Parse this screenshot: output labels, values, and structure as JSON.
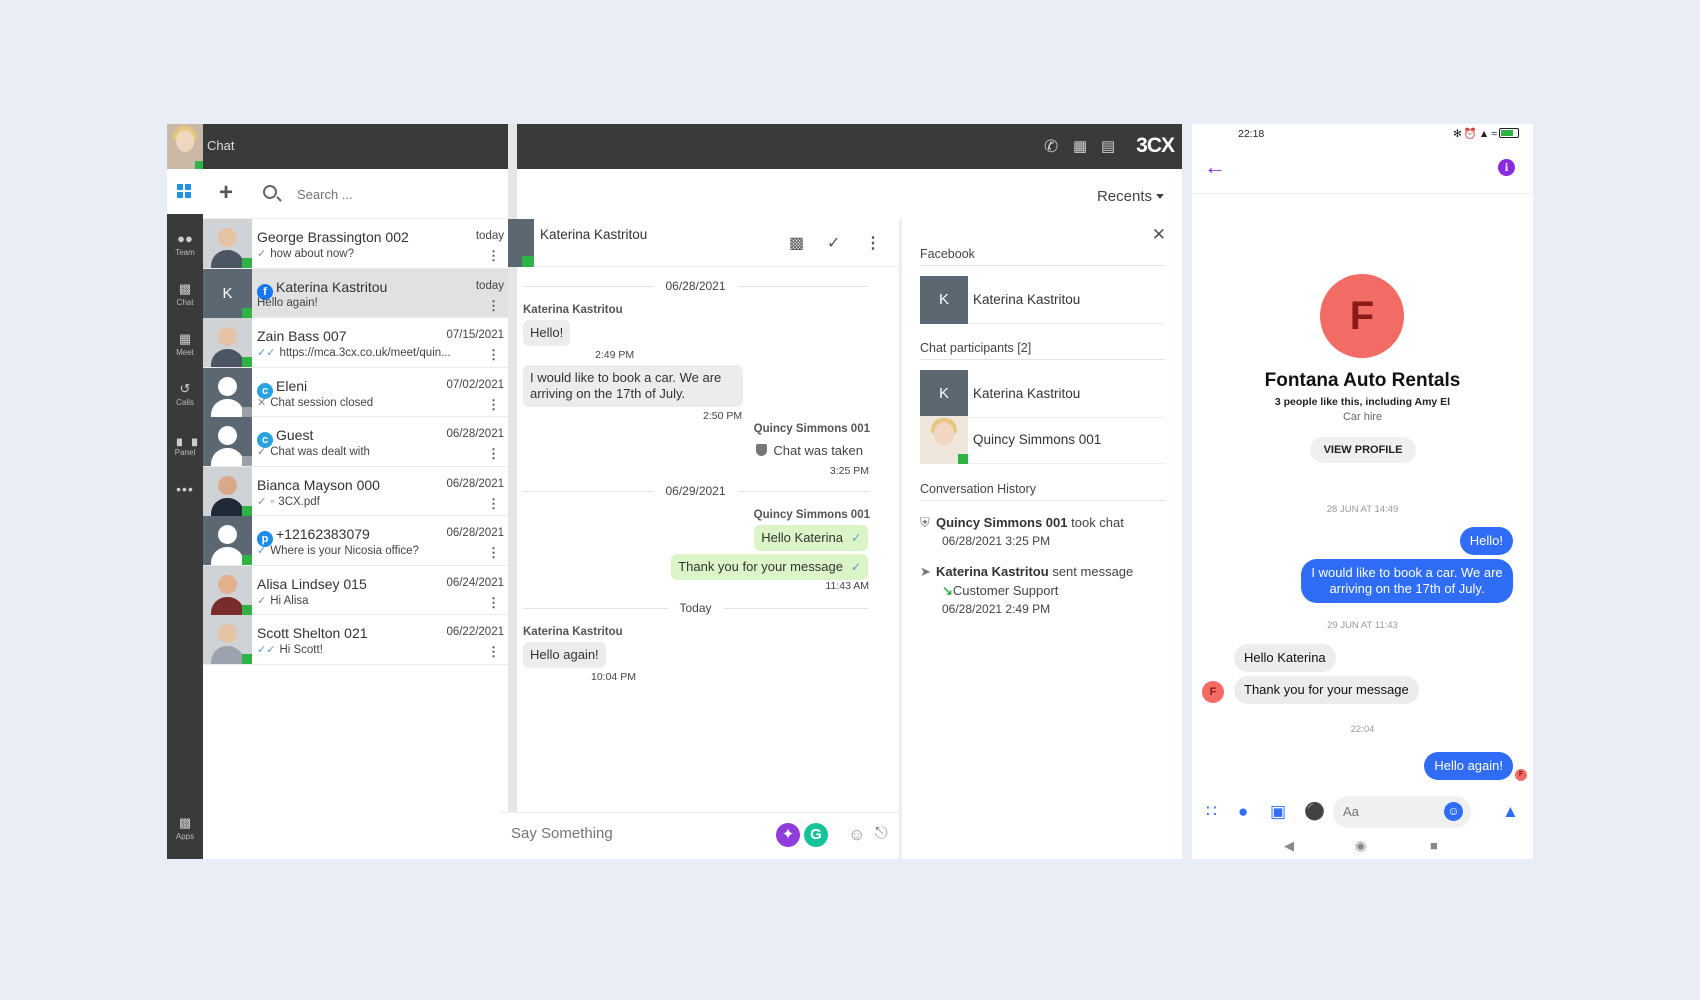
{
  "app": {
    "header_title": "Chat",
    "brand": "3CX",
    "search_placeholder": "Search ...",
    "recents_label": "Recents",
    "rail": [
      {
        "label": "Team",
        "icon": "team-icon"
      },
      {
        "label": "Chat",
        "icon": "chat-icon"
      },
      {
        "label": "Meet",
        "icon": "meet-icon"
      },
      {
        "label": "Calls",
        "icon": "calls-icon"
      },
      {
        "label": "Panel",
        "icon": "panel-icon"
      },
      {
        "label": "Apps",
        "icon": "apps-icon"
      }
    ],
    "more_label": "•••"
  },
  "chats": [
    {
      "name": "George Brassington 002",
      "preview": "how about now?",
      "date": "today",
      "tick": "✓",
      "avatar": "photo",
      "source": ""
    },
    {
      "name": "Katerina Kastritou",
      "preview": "Hello again!",
      "date": "today",
      "tick": "",
      "avatar": "K",
      "source": "f"
    },
    {
      "name": "Zain Bass 007",
      "preview": "https://mca.3cx.co.uk/meet/quin...",
      "date": "07/15/2021",
      "tick": "✓✓",
      "avatar": "photo",
      "source": ""
    },
    {
      "name": "Eleni",
      "preview": "Chat session closed",
      "date": "07/02/2021",
      "tick": "✕",
      "avatar": "ghost",
      "source": "c"
    },
    {
      "name": "Guest",
      "preview": "Chat was dealt with",
      "date": "06/28/2021",
      "tick": "✓",
      "avatar": "ghost",
      "source": "c"
    },
    {
      "name": "Bianca Mayson 000",
      "preview": "3CX.pdf",
      "date": "06/28/2021",
      "tick": "✓",
      "avatar": "photo",
      "source": ""
    },
    {
      "name": "+12162383079",
      "preview": "Where is your Nicosia office?",
      "date": "06/28/2021",
      "tick": "✓",
      "avatar": "ghost",
      "source": "p"
    },
    {
      "name": "Alisa Lindsey 015",
      "preview": "Hi Alisa",
      "date": "06/24/2021",
      "tick": "✓",
      "avatar": "photo",
      "source": ""
    },
    {
      "name": "Scott Shelton 021",
      "preview": "Hi Scott!",
      "date": "06/22/2021",
      "tick": "✓✓",
      "avatar": "photo",
      "source": ""
    }
  ],
  "conversation": {
    "contact": "Katerina Kastritou",
    "dates": [
      "06/28/2021",
      "06/29/2021",
      "Today"
    ],
    "m1_sender": "Katerina Kastritou",
    "m1_text": "Hello!",
    "m1_time": "2:49 PM",
    "m2_text_a": "I would like to book a car. We are",
    "m2_text_b": "arriving on the 17th of July.",
    "m2_time": "2:50 PM",
    "m3_sender": "Quincy Simmons 001",
    "m3_text": "Chat was taken",
    "m3_time": "3:25 PM",
    "m4_sender": "Quincy Simmons 001",
    "m4_text": "Hello Katerina",
    "m5_text": "Thank you for your message",
    "m5_time": "11:43 AM",
    "m6_sender": "Katerina Kastritou",
    "m6_text": "Hello again!",
    "m6_time": "10:04 PM",
    "composer_placeholder": "Say Something"
  },
  "details": {
    "facebook_label": "Facebook",
    "facebook_contact": "Katerina Kastritou",
    "participants_label": "Chat participants [2]",
    "participants": [
      "Katerina Kastritou",
      "Quincy Simmons 001"
    ],
    "history_label": "Conversation History",
    "h1_name": "Quincy Simmons 001",
    "h1_action": "took chat",
    "h1_time": "06/28/2021 3:25 PM",
    "h2_name": "Katerina Kastritou",
    "h2_action": "sent message",
    "h2_target": "Customer Support",
    "h2_time": "06/28/2021 2:49 PM"
  },
  "phone": {
    "time": "22:18",
    "page_initial": "F",
    "page_name": "Fontana Auto Rentals",
    "likes": "3 people like this, including Amy El",
    "category": "Car hire",
    "view_profile": "VIEW PROFILE",
    "date1": "28 JUN AT 14:49",
    "b1": "Hello!",
    "b2": "I would like to book a car. We are arriving on the 17th of July.",
    "date2": "29 JUN AT 11:43",
    "b3": "Hello Katerina",
    "b4": "Thank you for your message",
    "date3": "22:04",
    "b5": "Hello again!",
    "input_placeholder": "Aa"
  }
}
